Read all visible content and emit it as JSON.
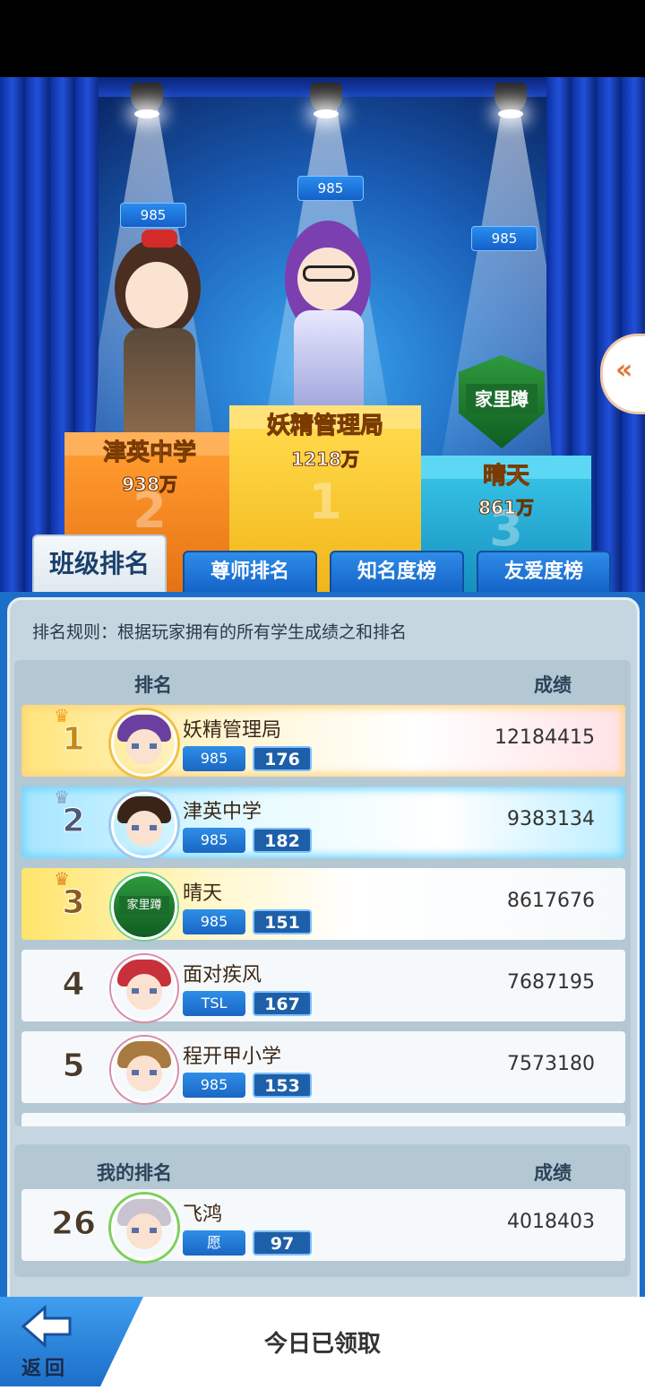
{
  "stage": {
    "top3": [
      {
        "place": "1",
        "name": "妖精管理局",
        "score": "1218万",
        "level": "985"
      },
      {
        "place": "2",
        "name": "津英中学",
        "score": "938万",
        "level": "985"
      },
      {
        "place": "3",
        "name": "晴天",
        "score": "861万",
        "level": "985",
        "emblem": "家里蹲"
      }
    ]
  },
  "tabs": [
    "班级排名",
    "尊师排名",
    "知名度榜",
    "友爱度榜"
  ],
  "rule": "排名规则：根据玩家拥有的所有学生成绩之和排名",
  "list": {
    "header_rank": "排名",
    "header_score": "成绩",
    "rows": [
      {
        "rank": "1",
        "name": "妖精管理局",
        "tag": "985",
        "level": "176",
        "score": "12184415"
      },
      {
        "rank": "2",
        "name": "津英中学",
        "tag": "985",
        "level": "182",
        "score": "9383134"
      },
      {
        "rank": "3",
        "name": "晴天",
        "tag": "985",
        "level": "151",
        "score": "8617676",
        "emblem": "家里蹲"
      },
      {
        "rank": "4",
        "name": "面对疾风",
        "tag": "TSL",
        "level": "167",
        "score": "7687195"
      },
      {
        "rank": "5",
        "name": "程开甲小学",
        "tag": "985",
        "level": "153",
        "score": "7573180"
      }
    ]
  },
  "my_rank": {
    "header_rank": "我的排名",
    "header_score": "成绩",
    "rank": "26",
    "name": "飞鸿",
    "tag": "愿",
    "level": "97",
    "score": "4018403"
  },
  "bottom": {
    "claim_text": "今日已领取",
    "back_label": "返回"
  },
  "icons": {
    "side_tab": "double-chevron-left-icon",
    "back": "back-arrow-icon",
    "crown": "crown-icon"
  },
  "colors": {
    "accent_blue": "#1c6fc8",
    "gold": "#ffd24a",
    "panel_bg": "#c5d6e0"
  }
}
